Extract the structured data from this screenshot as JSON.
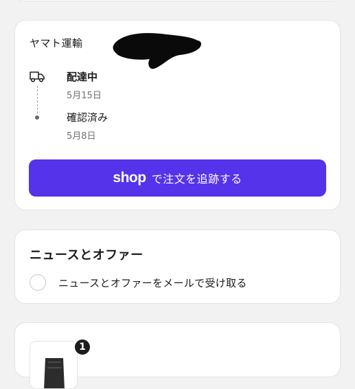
{
  "tracking": {
    "carrier_label": "ヤマト運輸",
    "steps": [
      {
        "title": "配達中",
        "date": "5月15日"
      },
      {
        "title": "確認済み",
        "date": "5月8日"
      }
    ],
    "shop_button": {
      "logo": "shop",
      "text": "で注文を追跡する"
    },
    "button_color": "#5433eb"
  },
  "news": {
    "heading": "ニュースとオファー",
    "checkbox_label": "ニュースとオファーをメールで受け取る"
  },
  "order": {
    "quantity_badge": "1"
  },
  "icons": {
    "delivery": "delivery-truck-icon"
  }
}
